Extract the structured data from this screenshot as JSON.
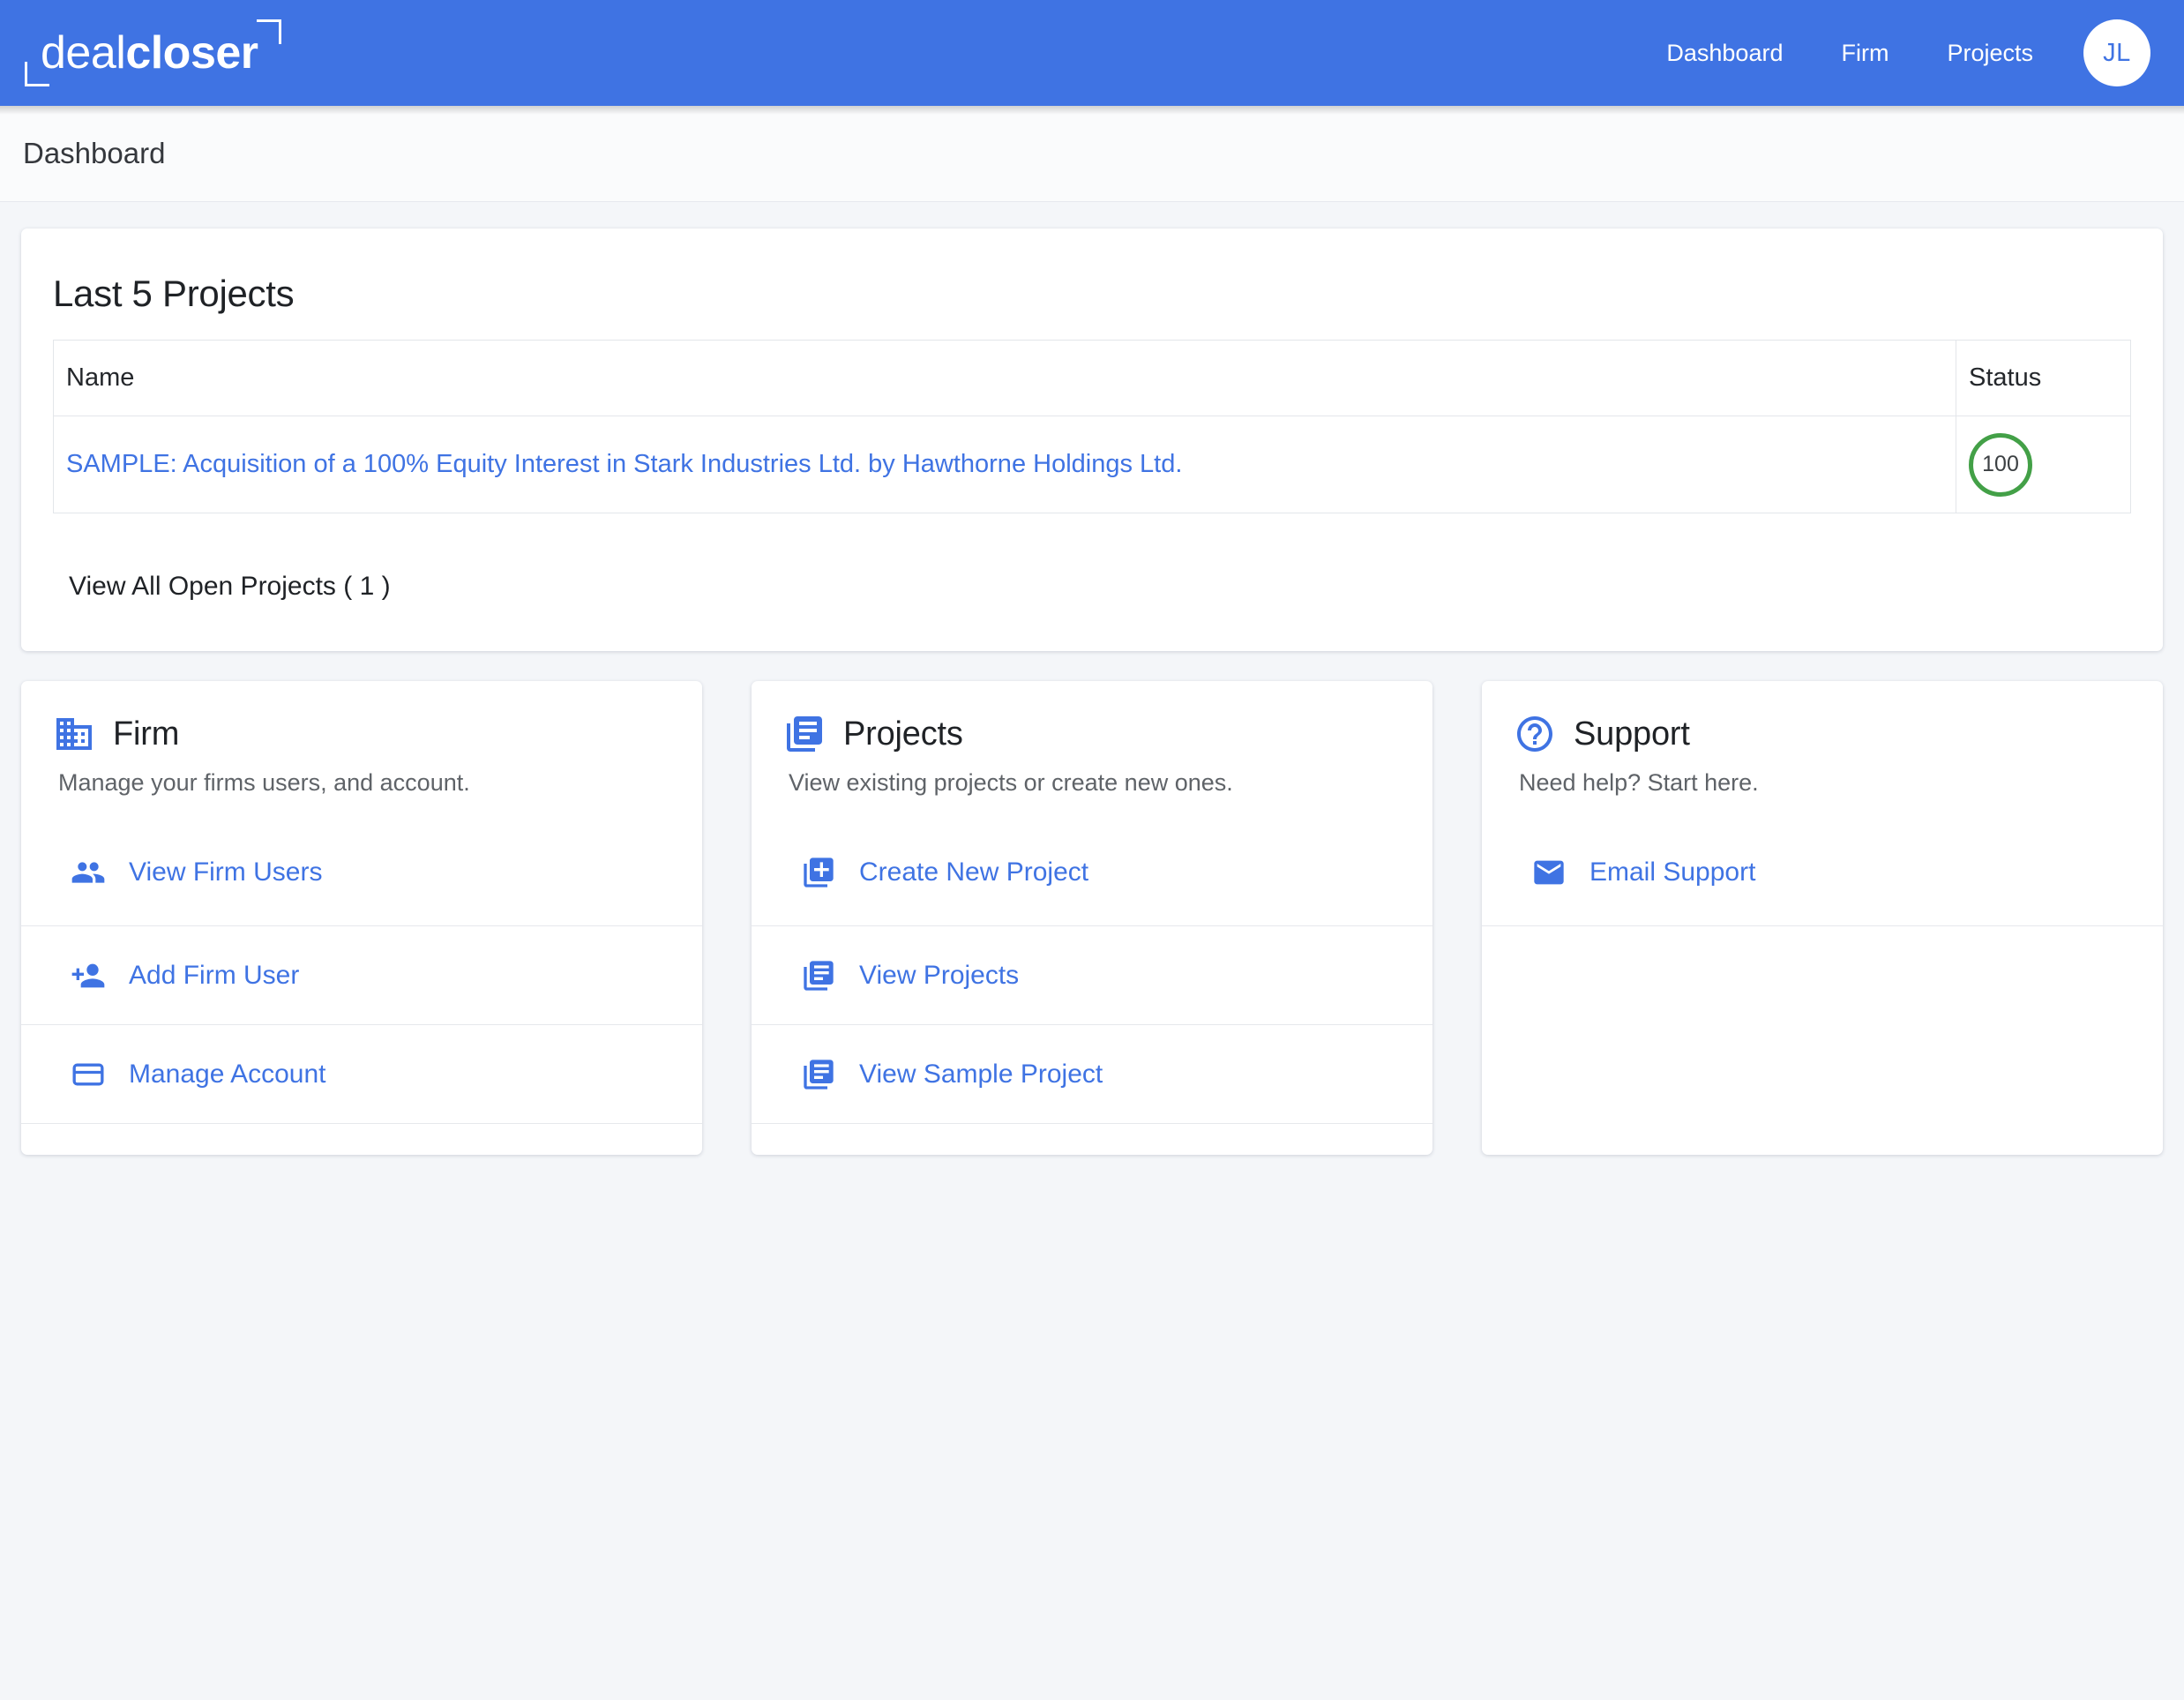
{
  "brand": {
    "logo_thin": "deal",
    "logo_bold": "closer",
    "accent_blue": "#3f73e3",
    "link_blue": "#3f73e3",
    "status_green": "#43a047"
  },
  "topnav": {
    "links": [
      {
        "label": "Dashboard",
        "name": "nav-dashboard"
      },
      {
        "label": "Firm",
        "name": "nav-firm"
      },
      {
        "label": "Projects",
        "name": "nav-projects"
      }
    ],
    "avatar_initials": "JL"
  },
  "breadcrumb": {
    "text": "Dashboard"
  },
  "projects_panel": {
    "heading": "Last 5 Projects",
    "columns": [
      "Name",
      "Status"
    ],
    "rows": [
      {
        "name": "SAMPLE: Acquisition of a 100% Equity Interest in Stark Industries Ltd. by Hawthorne Holdings Ltd.",
        "status": "100"
      }
    ],
    "view_all_label": "View All Open Projects ( 1 )"
  },
  "cards": [
    {
      "icon": "domain-icon",
      "title": "Firm",
      "subtitle": "Manage your firms users, and account.",
      "links": [
        {
          "icon": "people-icon",
          "label": "View Firm Users"
        },
        {
          "icon": "person-add-icon",
          "label": "Add Firm User"
        },
        {
          "icon": "credit-card-icon",
          "label": "Manage Account"
        }
      ]
    },
    {
      "icon": "library-books-icon",
      "title": "Projects",
      "subtitle": "View existing projects or create new ones.",
      "links": [
        {
          "icon": "library-add-icon",
          "label": "Create New Project"
        },
        {
          "icon": "library-books-icon",
          "label": "View Projects"
        },
        {
          "icon": "library-books-icon",
          "label": "View Sample Project"
        }
      ]
    },
    {
      "icon": "help-outline-icon",
      "title": "Support",
      "subtitle": "Need help? Start here.",
      "links": [
        {
          "icon": "email-icon",
          "label": "Email Support"
        }
      ]
    }
  ]
}
